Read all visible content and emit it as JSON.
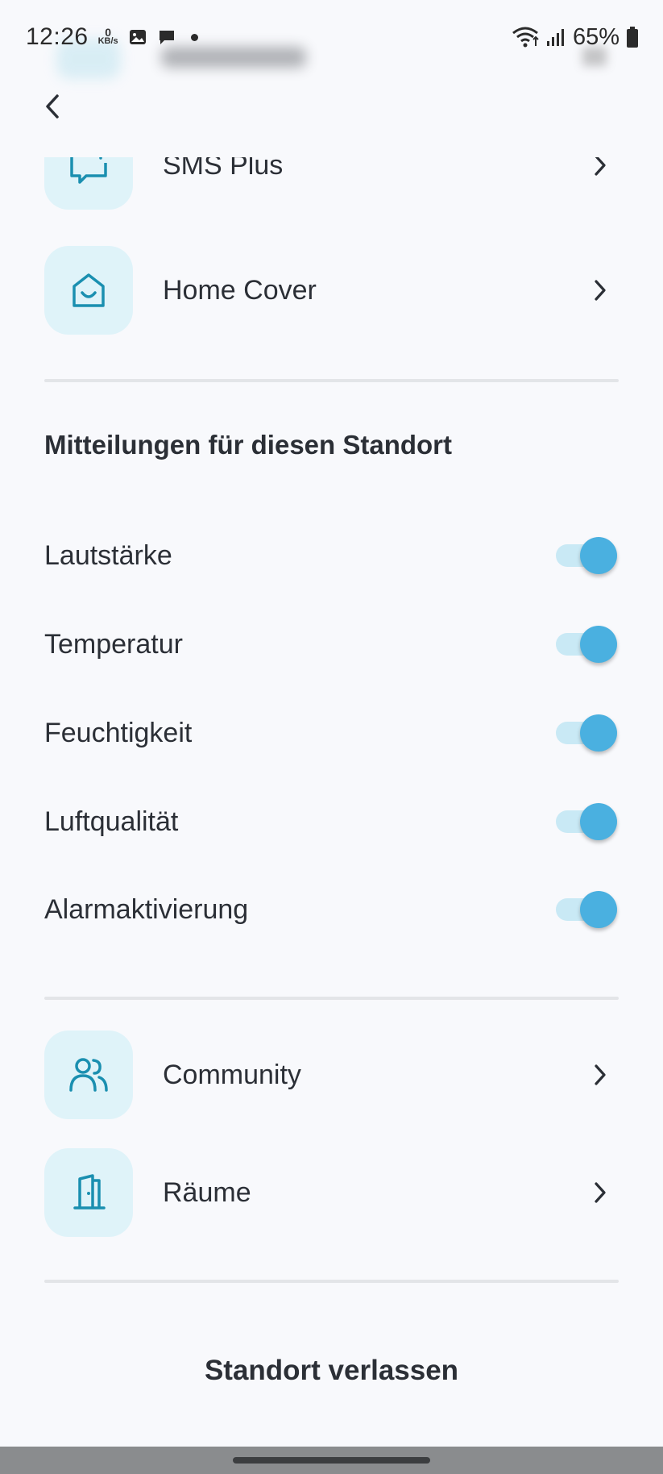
{
  "status_bar": {
    "time": "12:26",
    "net_speed_value": "0",
    "net_speed_unit": "KB/s",
    "battery": "65%"
  },
  "nav_top": [
    {
      "label": "SMS Plus",
      "icon": "chat-plus-icon"
    },
    {
      "label": "Home Cover",
      "icon": "home-smile-icon"
    }
  ],
  "notifications": {
    "title": "Mitteilungen für diesen Standort",
    "items": [
      {
        "label": "Lautstärke",
        "enabled": true
      },
      {
        "label": "Temperatur",
        "enabled": true
      },
      {
        "label": "Feuchtigkeit",
        "enabled": true
      },
      {
        "label": "Luftqualität",
        "enabled": true
      },
      {
        "label": "Alarmaktivierung",
        "enabled": true
      }
    ]
  },
  "nav_bottom": [
    {
      "label": "Community",
      "icon": "community-icon"
    },
    {
      "label": "Räume",
      "icon": "door-icon"
    }
  ],
  "leave_label": "Standort verlassen",
  "colors": {
    "accent": "#4ab0e0",
    "icon_teal": "#1a8fb0",
    "icon_bg": "#dff3f9"
  }
}
